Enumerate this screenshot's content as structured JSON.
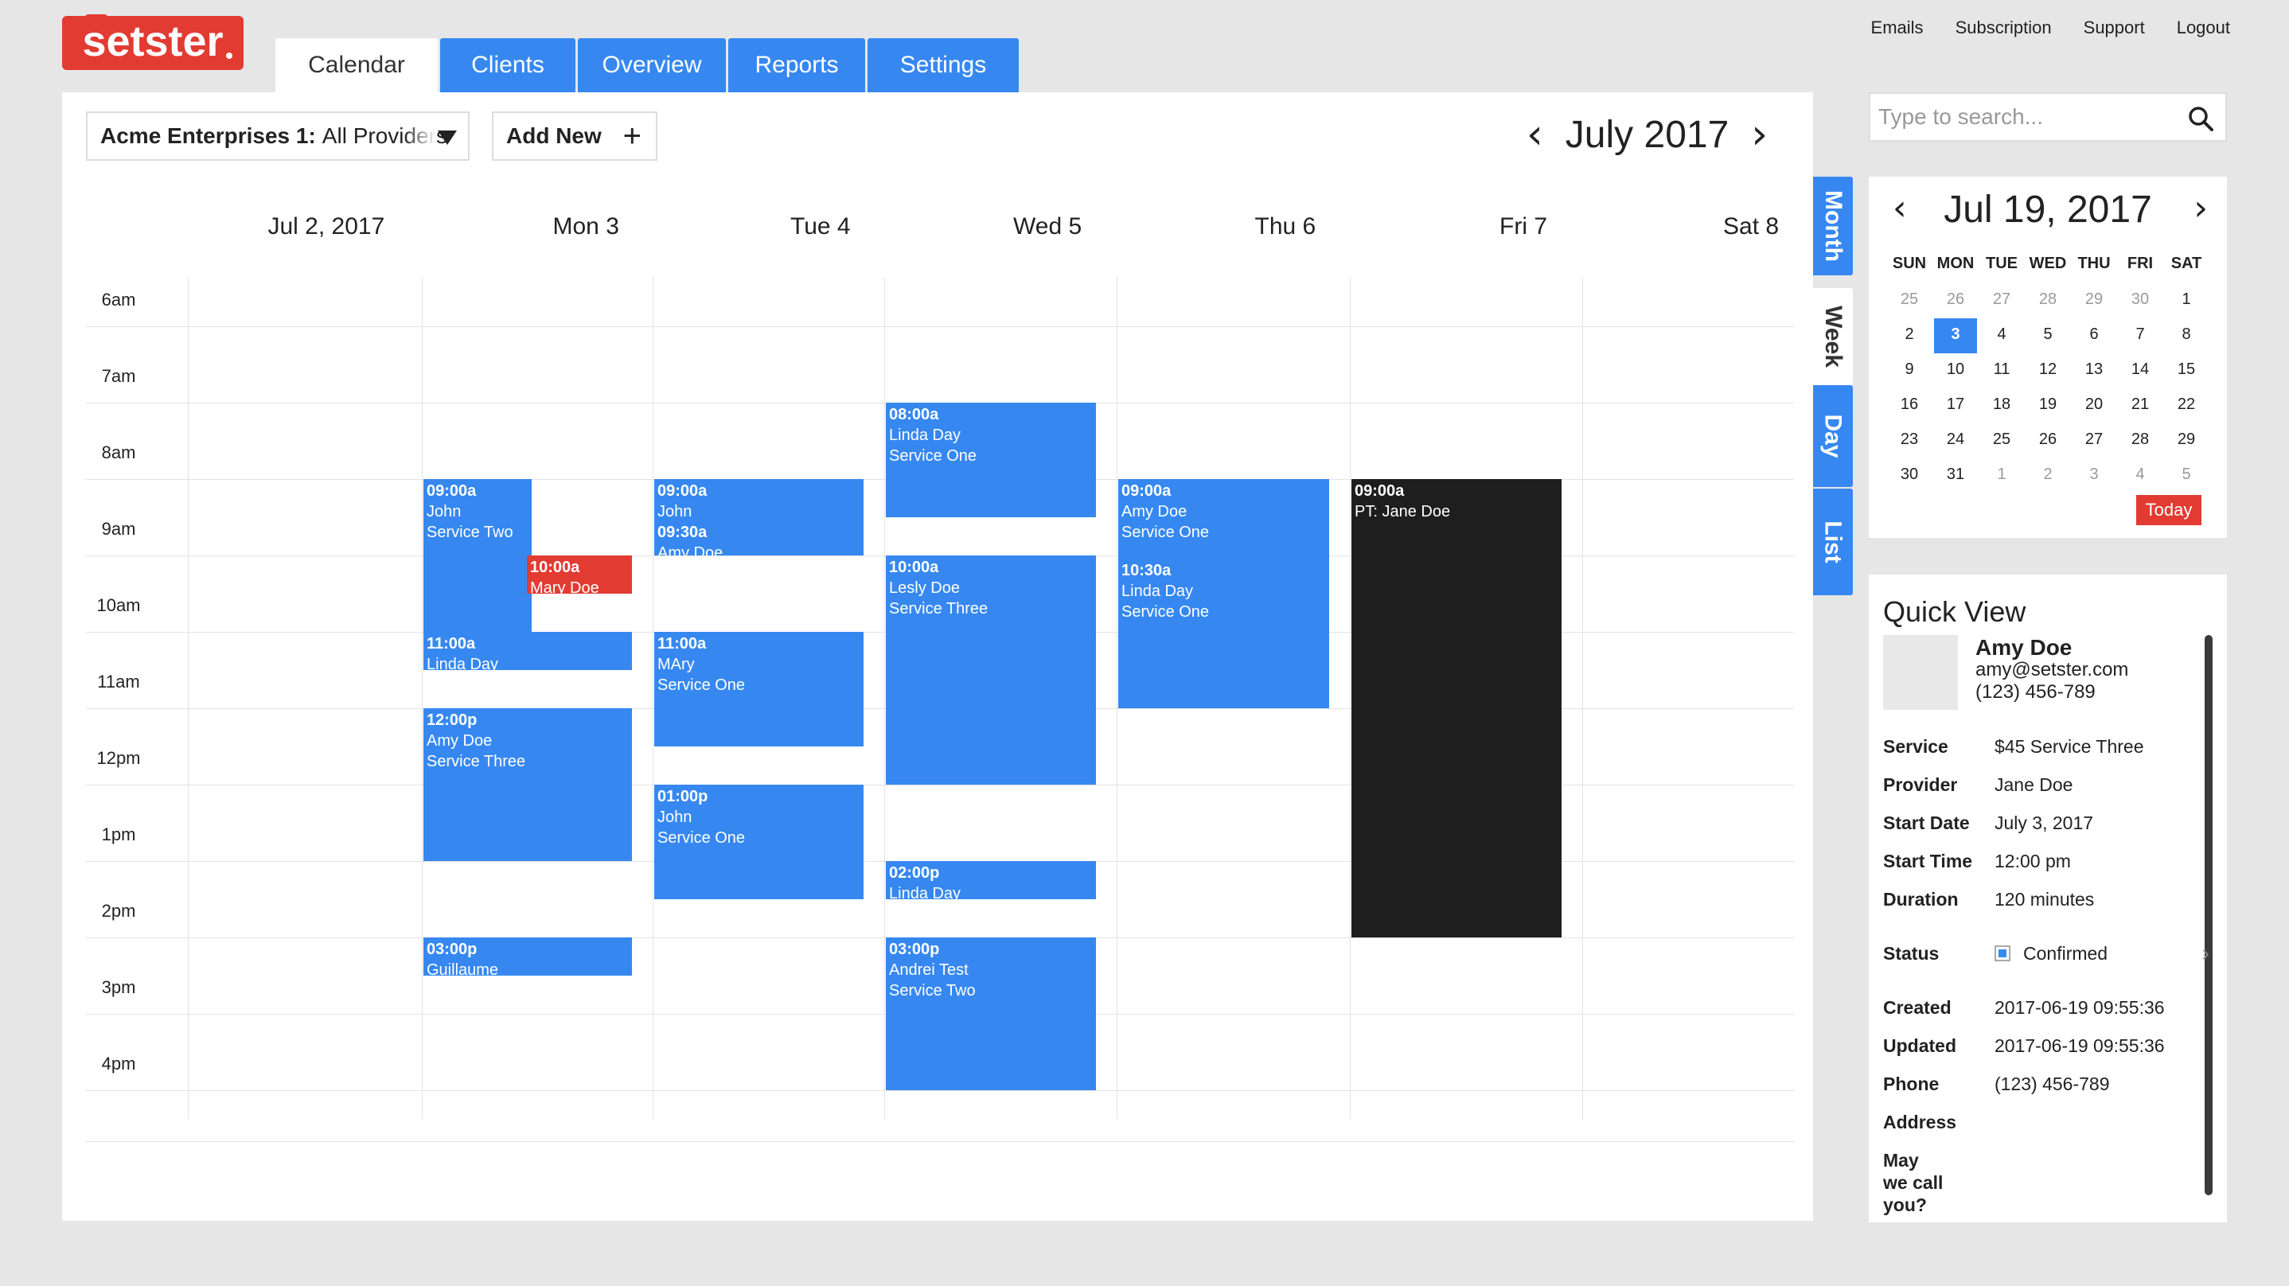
{
  "brand": {
    "name": "setster"
  },
  "nav": {
    "tabs": [
      {
        "label": "Calendar",
        "active": true
      },
      {
        "label": "Clients",
        "active": false
      },
      {
        "label": "Overview",
        "active": false
      },
      {
        "label": "Reports",
        "active": false
      },
      {
        "label": "Settings",
        "active": false
      }
    ]
  },
  "toplinks": [
    "Emails",
    "Subscription",
    "Support",
    "Logout"
  ],
  "toolbar": {
    "provider_bold": "Acme Enterprises 1:",
    "provider_rest": "All Providers",
    "add_new_label": "Add New",
    "add_new_icon": "+",
    "month_title": "July 2017"
  },
  "calendar": {
    "day_headers": [
      "Jul 2, 2017",
      "Mon 3",
      "Tue 4",
      "Wed 5",
      "Thu 6",
      "Fri 7",
      "Sat 8"
    ],
    "hours": [
      "6am",
      "7am",
      "8am",
      "9am",
      "10am",
      "11am",
      "12pm",
      "1pm",
      "2pm",
      "3pm",
      "4pm"
    ],
    "events": [
      {
        "day": 1,
        "start": "09:00",
        "end": "11:00",
        "lines": [
          "09:00a",
          "John",
          "Service Two"
        ],
        "color": "blue",
        "half": "left"
      },
      {
        "day": 1,
        "start": "10:00",
        "end": "10:30",
        "lines": [
          "10:00a",
          "Mary Doe"
        ],
        "color": "red",
        "half": "right"
      },
      {
        "day": 1,
        "start": "11:00",
        "end": "11:30",
        "lines": [
          "11:00a",
          "Linda Day"
        ],
        "color": "blue"
      },
      {
        "day": 1,
        "start": "12:00",
        "end": "14:00",
        "lines": [
          "12:00p",
          "Amy Doe",
          "Service Three"
        ],
        "color": "blue"
      },
      {
        "day": 1,
        "start": "15:00",
        "end": "15:30",
        "lines": [
          "03:00p",
          "Guillaume"
        ],
        "color": "blue"
      },
      {
        "day": 2,
        "start": "09:00",
        "end": "10:00",
        "lines": [
          "09:00a",
          "John",
          "09:30a",
          "Amy Doe"
        ],
        "color": "blue",
        "bold_lines": [
          0,
          2
        ]
      },
      {
        "day": 2,
        "start": "11:00",
        "end": "12:30",
        "lines": [
          "11:00a",
          "MAry",
          "Service One"
        ],
        "color": "blue"
      },
      {
        "day": 2,
        "start": "13:00",
        "end": "14:30",
        "lines": [
          "01:00p",
          "John",
          "Service One"
        ],
        "color": "blue"
      },
      {
        "day": 3,
        "start": "08:00",
        "end": "09:30",
        "lines": [
          "08:00a",
          "Linda Day",
          "Service One"
        ],
        "color": "blue"
      },
      {
        "day": 3,
        "start": "10:00",
        "end": "13:00",
        "lines": [
          "10:00a",
          "Lesly Doe",
          "Service Three"
        ],
        "color": "blue"
      },
      {
        "day": 3,
        "start": "14:00",
        "end": "14:30",
        "lines": [
          "02:00p",
          "Linda Day"
        ],
        "color": "blue"
      },
      {
        "day": 3,
        "start": "15:00",
        "end": "17:00",
        "lines": [
          "03:00p",
          "Andrei Test",
          "Service Two"
        ],
        "color": "blue"
      },
      {
        "day": 4,
        "start": "09:00",
        "end": "12:00",
        "lines": [
          "09:00a",
          "Amy Doe",
          "Service One",
          "",
          "10:30a",
          "Linda Day",
          "Service One"
        ],
        "color": "blue",
        "bold_lines": [
          0,
          4
        ]
      },
      {
        "day": 5,
        "start": "09:00",
        "end": "15:00",
        "lines": [
          "09:00a",
          "PT: Jane Doe"
        ],
        "color": "black"
      }
    ]
  },
  "views": [
    {
      "label": "Month",
      "active": false
    },
    {
      "label": "Week",
      "active": true
    },
    {
      "label": "Day",
      "active": false
    },
    {
      "label": "List",
      "active": false
    }
  ],
  "search": {
    "placeholder": "Type to search...",
    "icon": "search-icon"
  },
  "mini_calendar": {
    "title": "Jul 19, 2017",
    "weekdays": [
      "SUN",
      "MON",
      "TUE",
      "WED",
      "THU",
      "FRI",
      "SAT"
    ],
    "weeks": [
      [
        [
          "25",
          true
        ],
        [
          "26",
          true
        ],
        [
          "27",
          true
        ],
        [
          "28",
          true
        ],
        [
          "29",
          true
        ],
        [
          "30",
          true
        ],
        [
          "1",
          false
        ]
      ],
      [
        [
          "2",
          false
        ],
        [
          "3",
          false
        ],
        [
          "4",
          false
        ],
        [
          "5",
          false
        ],
        [
          "6",
          false
        ],
        [
          "7",
          false
        ],
        [
          "8",
          false
        ]
      ],
      [
        [
          "9",
          false
        ],
        [
          "10",
          false
        ],
        [
          "11",
          false
        ],
        [
          "12",
          false
        ],
        [
          "13",
          false
        ],
        [
          "14",
          false
        ],
        [
          "15",
          false
        ]
      ],
      [
        [
          "16",
          false
        ],
        [
          "17",
          false
        ],
        [
          "18",
          false
        ],
        [
          "19",
          false
        ],
        [
          "20",
          false
        ],
        [
          "21",
          false
        ],
        [
          "22",
          false
        ]
      ],
      [
        [
          "23",
          false
        ],
        [
          "24",
          false
        ],
        [
          "25",
          false
        ],
        [
          "26",
          false
        ],
        [
          "27",
          false
        ],
        [
          "28",
          false
        ],
        [
          "29",
          false
        ]
      ],
      [
        [
          "30",
          false
        ],
        [
          "31",
          false
        ],
        [
          "1",
          true
        ],
        [
          "2",
          true
        ],
        [
          "3",
          true
        ],
        [
          "4",
          true
        ],
        [
          "5",
          true
        ]
      ]
    ],
    "selected": "3",
    "today_label": "Today"
  },
  "quick_view": {
    "title": "Quick View",
    "name": "Amy Doe",
    "email": "amy@setster.com",
    "phone": "(123) 456-789",
    "fields": [
      {
        "key": "Service",
        "value": "$45 Service Three"
      },
      {
        "key": "Provider",
        "value": "Jane Doe"
      },
      {
        "key": "Start Date",
        "value": "July 3, 2017"
      },
      {
        "key": "Start Time",
        "value": "12:00 pm"
      },
      {
        "key": "Duration",
        "value": "120 minutes"
      }
    ],
    "status_label": "Status",
    "status_value": "Confirmed",
    "fields2": [
      {
        "key": "Created",
        "value": "2017-06-19 09:55:36"
      },
      {
        "key": "Updated",
        "value": "2017-06-19 09:55:36"
      },
      {
        "key": "Phone",
        "value": "(123) 456-789"
      },
      {
        "key": "Address",
        "value": ""
      },
      {
        "key": "May we call you?",
        "value": ""
      }
    ]
  },
  "colors": {
    "accent": "#3688f0",
    "brand_red": "#e23b32",
    "black_event": "#1e1e1e"
  }
}
